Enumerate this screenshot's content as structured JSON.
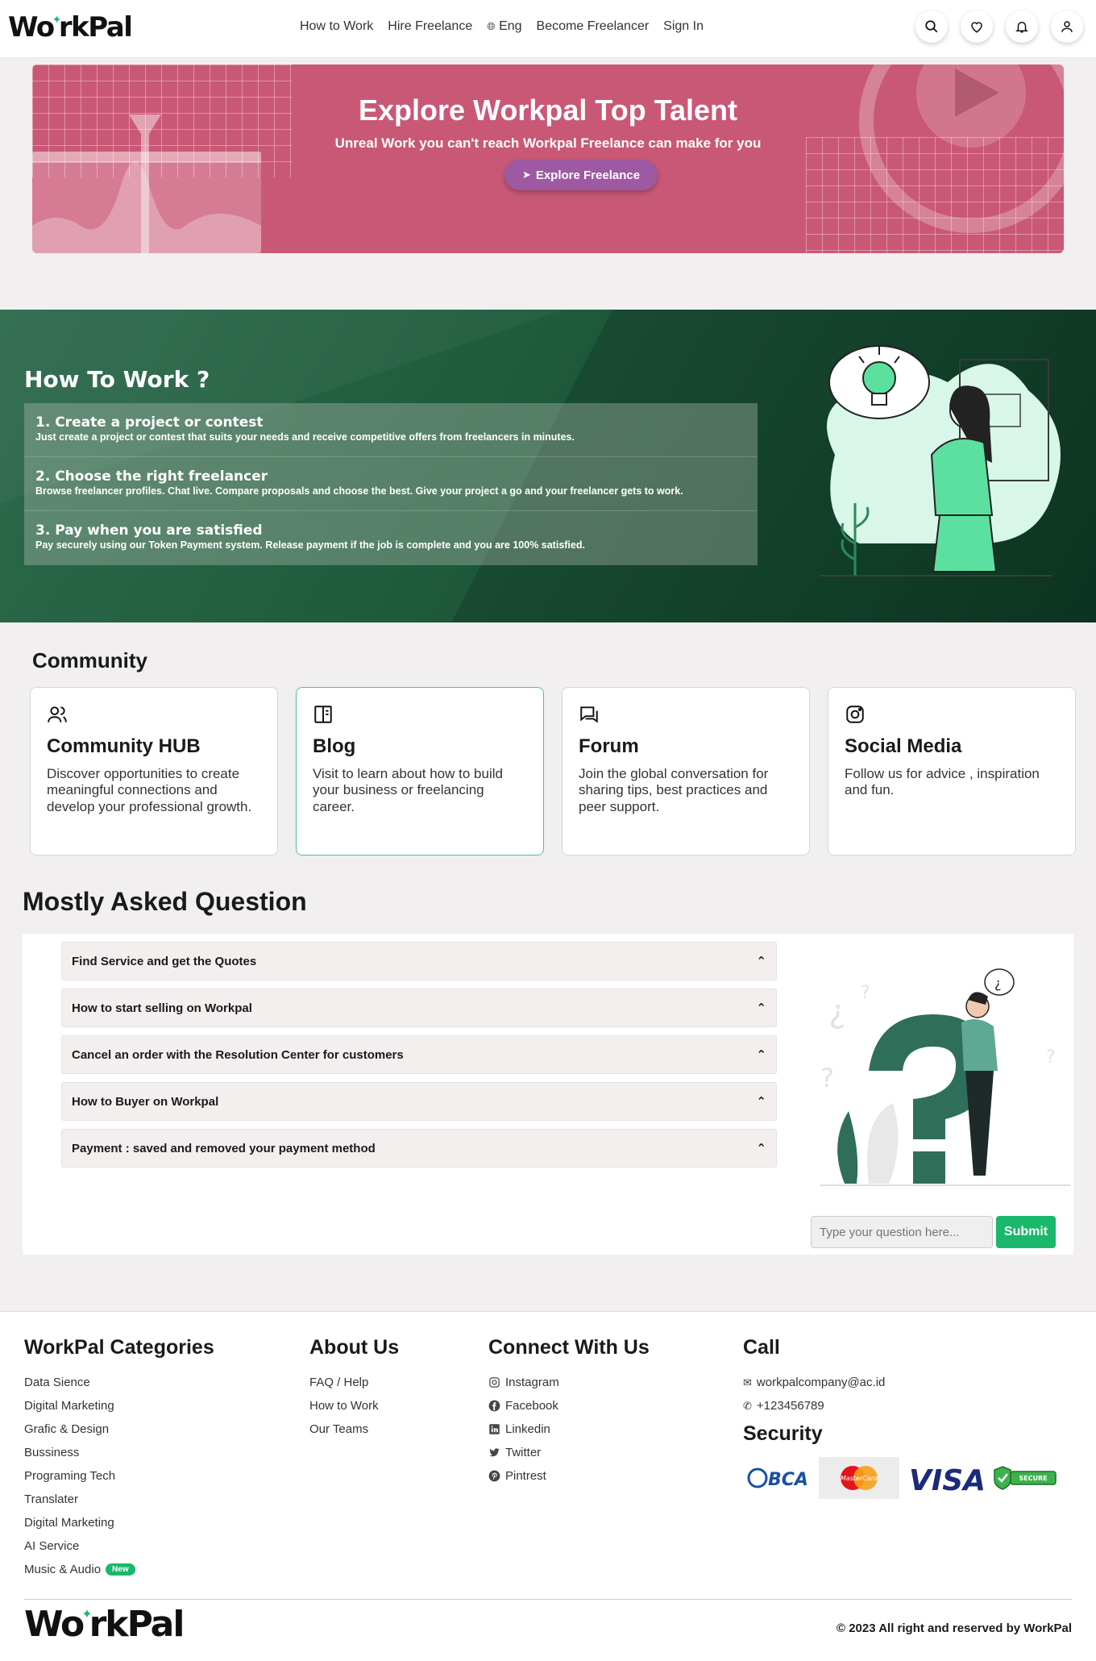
{
  "brand": {
    "logo_left": "Wo",
    "logo_right": "rkPal"
  },
  "nav": {
    "links": [
      "How to Work",
      "Hire Freelance",
      "Eng",
      "Become Freelancer",
      "Sign In"
    ]
  },
  "hero": {
    "title": "Explore Workpal Top Talent",
    "subtitle": "Unreal Work you can't reach Workpal Freelance can make for you",
    "button": "Explore Freelance"
  },
  "how": {
    "title": "How To Work ?",
    "steps": [
      {
        "title": "1. Create a project or contest",
        "desc": "Just create a project or contest that suits your needs and receive competitive offers from freelancers in minutes."
      },
      {
        "title": "2. Choose the right freelancer",
        "desc": "Browse freelancer profiles. Chat live. Compare proposals and choose the best. Give your project a go and your freelancer gets to work."
      },
      {
        "title": "3. Pay when you are satisfied",
        "desc": "Pay securely using our Token Payment system. Release payment if the job is complete and you are 100% satisfied."
      }
    ]
  },
  "community": {
    "title": "Community",
    "cards": [
      {
        "title": "Community HUB",
        "desc": "Discover opportunities to create meaningful connections and develop your professional growth.",
        "icon": "users-icon"
      },
      {
        "title": "Blog",
        "desc": "Visit to learn about how to build your business or freelancing career.",
        "icon": "book-icon"
      },
      {
        "title": "Forum",
        "desc": "Join the global conversation for sharing tips, best practices and peer support.",
        "icon": "chat-icon"
      },
      {
        "title": "Social Media",
        "desc": "Follow us for advice , inspiration and fun.",
        "icon": "instagram-icon"
      }
    ]
  },
  "faq": {
    "title": "Mostly Asked Question",
    "items": [
      "Find Service and get the Quotes",
      "How to start selling on Workpal",
      "Cancel an order with the Resolution Center for customers",
      "How to Buyer on Workpal",
      "Payment : saved and removed your payment method"
    ],
    "input_placeholder": "Type your question here...",
    "submit": "Submit"
  },
  "footer": {
    "categories": {
      "title": "WorkPal Categories",
      "items": [
        "Data Sience",
        "Digital Marketing",
        "Grafic & Design",
        "Bussiness",
        "Programing Tech",
        "Translater",
        "Digital Marketing",
        "AI Service",
        "Music & Audio"
      ],
      "new_badge": "New"
    },
    "about": {
      "title": "About Us",
      "items": [
        "FAQ / Help",
        "How to Work",
        "Our Teams"
      ]
    },
    "connect": {
      "title": "Connect With Us",
      "items": [
        "Instagram",
        "Facebook",
        "Linkedin",
        "Twitter",
        "Pintrest"
      ]
    },
    "call": {
      "title": "Call",
      "email": "workpalcompany@ac.id",
      "phone": "+123456789"
    },
    "security": {
      "title": "Security",
      "logos": [
        "BCA",
        "MasterCard",
        "VISA",
        "SECURE"
      ]
    },
    "copyright": "© 2023 All right and reserved by WorkPal"
  }
}
